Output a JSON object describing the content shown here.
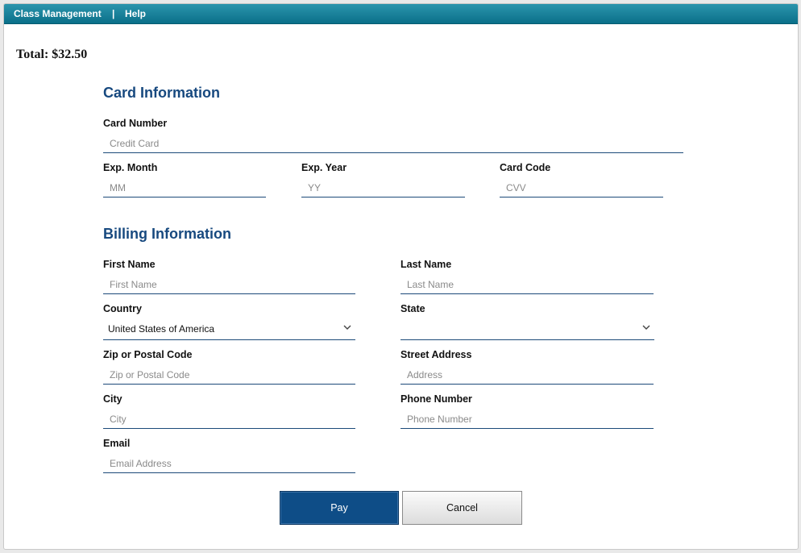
{
  "nav": {
    "class_management": "Class Management",
    "separator": "|",
    "help": "Help"
  },
  "total": "Total: $32.50",
  "card": {
    "title": "Card Information",
    "number": {
      "label": "Card Number",
      "placeholder": "Credit Card"
    },
    "exp_month": {
      "label": "Exp. Month",
      "placeholder": "MM"
    },
    "exp_year": {
      "label": "Exp. Year",
      "placeholder": "YY"
    },
    "code": {
      "label": "Card Code",
      "placeholder": "CVV"
    }
  },
  "billing": {
    "title": "Billing Information",
    "first_name": {
      "label": "First Name",
      "placeholder": "First Name"
    },
    "last_name": {
      "label": "Last Name",
      "placeholder": "Last Name"
    },
    "country": {
      "label": "Country",
      "value": "United States of America"
    },
    "state": {
      "label": "State",
      "value": ""
    },
    "zip": {
      "label": "Zip or Postal Code",
      "placeholder": "Zip or Postal Code"
    },
    "street": {
      "label": "Street Address",
      "placeholder": "Address"
    },
    "city": {
      "label": "City",
      "placeholder": "City"
    },
    "phone": {
      "label": "Phone Number",
      "placeholder": "Phone Number"
    },
    "email": {
      "label": "Email",
      "placeholder": "Email Address"
    }
  },
  "buttons": {
    "pay": "Pay",
    "cancel": "Cancel"
  },
  "icons": {
    "dropdown": "chevron-down-icon"
  },
  "colors": {
    "header": "#0a6f89",
    "accent": "#17497f",
    "pay_button": "#0e4d87"
  }
}
